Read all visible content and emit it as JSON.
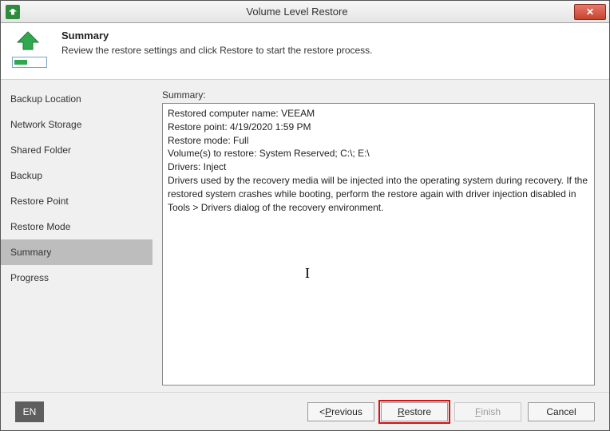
{
  "window": {
    "title": "Volume Level Restore",
    "close_symbol": "✕"
  },
  "header": {
    "title": "Summary",
    "subtitle": "Review the restore settings and click Restore to start the restore process."
  },
  "sidebar": {
    "items": [
      {
        "label": "Backup Location"
      },
      {
        "label": "Network Storage"
      },
      {
        "label": "Shared Folder"
      },
      {
        "label": "Backup"
      },
      {
        "label": "Restore Point"
      },
      {
        "label": "Restore Mode"
      },
      {
        "label": "Summary"
      },
      {
        "label": "Progress"
      }
    ],
    "active_index": 6
  },
  "main": {
    "summary_label": "Summary:",
    "lines": [
      "Restored computer name: VEEAM",
      "Restore point: 4/19/2020 1:59 PM",
      "Restore mode: Full",
      "Volume(s) to restore: System Reserved; C:\\; E:\\",
      "Drivers: Inject",
      "Drivers used by the recovery media will be injected into the operating system during recovery. If the restored system crashes while booting, perform the restore again with driver injection disabled in Tools > Drivers dialog of the recovery environment."
    ]
  },
  "footer": {
    "language": "EN",
    "previous_prefix": "< ",
    "previous_u": "P",
    "previous_rest": "revious",
    "restore_u": "R",
    "restore_rest": "estore",
    "finish_u": "F",
    "finish_rest": "inish",
    "cancel_label": "Cancel"
  }
}
